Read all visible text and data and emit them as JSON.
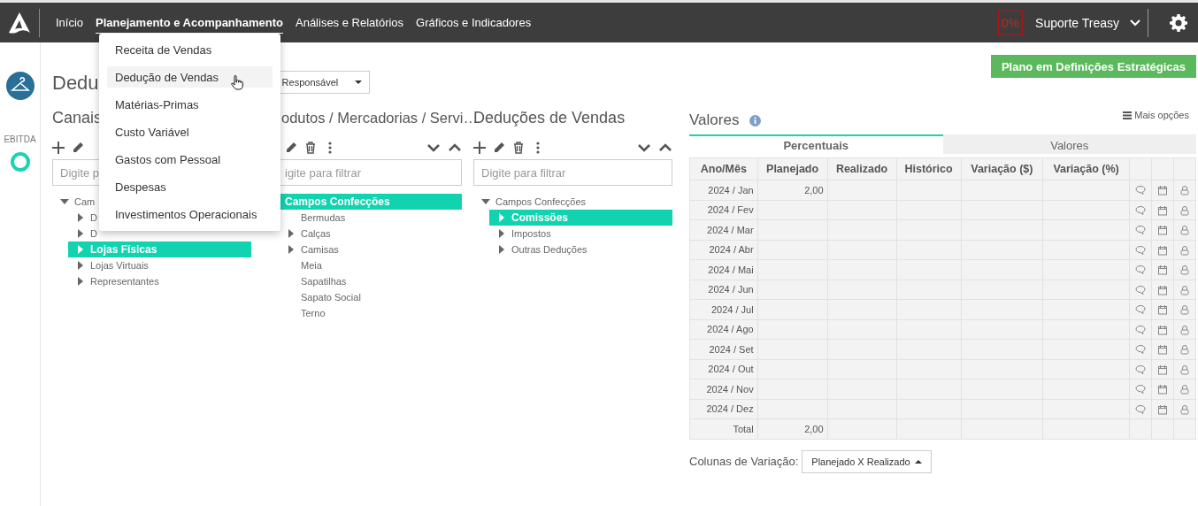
{
  "nav": {
    "items": [
      {
        "label": "Início",
        "selected": false
      },
      {
        "label": "Planejamento e Acompanhamento",
        "selected": true
      },
      {
        "label": "Análises e Relatórios",
        "selected": false
      },
      {
        "label": "Gráficos e Indicadores",
        "selected": false
      }
    ],
    "progress": "0%",
    "user": "Suporte Treasy"
  },
  "menu": {
    "items": [
      {
        "label": "Receita de Vendas",
        "highlighted": false
      },
      {
        "label": "Dedução de Vendas",
        "highlighted": true
      },
      {
        "label": "Matérias-Primas",
        "highlighted": false
      },
      {
        "label": "Custo Variável",
        "highlighted": false
      },
      {
        "label": "Gastos com Pessoal",
        "highlighted": false
      },
      {
        "label": "Despesas",
        "highlighted": false
      },
      {
        "label": "Investimentos Operacionais",
        "highlighted": false
      }
    ]
  },
  "sidebar": {
    "label": "EBITDA"
  },
  "page": {
    "title": "Dedu",
    "filter_dropdown": "Responsável",
    "status_button": "Plano em Definições Estratégicas"
  },
  "panels": [
    {
      "title": "Canais",
      "tools": [
        {
          "kind": "add"
        },
        {
          "kind": "edit"
        }
      ],
      "filter_placeholder": "Digite p",
      "tree": [
        {
          "label": "Cam",
          "kind": "open",
          "selected": false,
          "children": [
            {
              "label": "D",
              "kind": "closed",
              "selected": false
            },
            {
              "label": "D",
              "kind": "closed",
              "selected": false
            },
            {
              "label": "Lojas Físicas",
              "kind": "closed",
              "selected": true
            },
            {
              "label": "Lojas Virtuais",
              "kind": "closed",
              "selected": false
            },
            {
              "label": "Representantes",
              "kind": "closed",
              "selected": false
            }
          ]
        }
      ]
    },
    {
      "title": "odutos / Mercadorias / Servi…",
      "tools": [
        {
          "kind": "edit"
        },
        {
          "kind": "delete"
        },
        {
          "kind": "more"
        }
      ],
      "expand_controls": true,
      "filter_placeholder": "igite para filtrar",
      "tree": [
        {
          "label": "Campos Confecções",
          "kind": "leaf",
          "selected": true,
          "children": [
            {
              "label": "Bermudas",
              "kind": "leaf",
              "selected": false
            },
            {
              "label": "Calças",
              "kind": "closed",
              "selected": false
            },
            {
              "label": "Camisas",
              "kind": "closed",
              "selected": false
            },
            {
              "label": "Meia",
              "kind": "leaf",
              "selected": false
            },
            {
              "label": "Sapatilhas",
              "kind": "leaf",
              "selected": false
            },
            {
              "label": "Sapato Social",
              "kind": "leaf",
              "selected": false
            },
            {
              "label": "Terno",
              "kind": "leaf",
              "selected": false
            }
          ]
        }
      ]
    },
    {
      "title": "Deduções de Vendas",
      "tools": [
        {
          "kind": "add"
        },
        {
          "kind": "edit"
        },
        {
          "kind": "delete"
        },
        {
          "kind": "more"
        }
      ],
      "expand_controls": true,
      "filter_placeholder": "Digite para filtrar",
      "tree": [
        {
          "label": "Campos Confecções",
          "kind": "open",
          "selected": false,
          "children": [
            {
              "label": "Comissões",
              "kind": "closed",
              "selected": true
            },
            {
              "label": "Impostos",
              "kind": "closed",
              "selected": false
            },
            {
              "label": "Outras Deduções",
              "kind": "closed",
              "selected": false
            }
          ]
        }
      ]
    }
  ],
  "values": {
    "title": "Valores",
    "more_options": "Mais opções",
    "tabs": [
      {
        "label": "Percentuais",
        "selected": true
      },
      {
        "label": "Valores",
        "selected": false
      }
    ],
    "columns": [
      "Ano/Mês",
      "Planejado",
      "Realizado",
      "Histórico",
      "Variação ($)",
      "Variação (%)"
    ],
    "rows": [
      {
        "kind": "month",
        "cells": [
          "2024 / Jan",
          "2,00"
        ]
      },
      {
        "kind": "month",
        "cells": [
          "2024 / Fev"
        ]
      },
      {
        "kind": "month",
        "cells": [
          "2024 / Mar"
        ]
      },
      {
        "kind": "month",
        "cells": [
          "2024 / Abr"
        ]
      },
      {
        "kind": "month",
        "cells": [
          "2024 / Mai"
        ]
      },
      {
        "kind": "month",
        "cells": [
          "2024 / Jun"
        ]
      },
      {
        "kind": "month",
        "cells": [
          "2024 / Jul"
        ]
      },
      {
        "kind": "month",
        "cells": [
          "2024 / Ago"
        ]
      },
      {
        "kind": "month",
        "cells": [
          "2024 / Set"
        ]
      },
      {
        "kind": "month",
        "cells": [
          "2024 / Out"
        ]
      },
      {
        "kind": "month",
        "cells": [
          "2024 / Nov"
        ]
      },
      {
        "kind": "month",
        "cells": [
          "2024 / Dez"
        ]
      },
      {
        "kind": "total",
        "cells": [
          "Total",
          "2,00"
        ]
      }
    ],
    "variation": {
      "label": "Colunas de Variação:",
      "value": "Planejado X Realizado"
    }
  }
}
